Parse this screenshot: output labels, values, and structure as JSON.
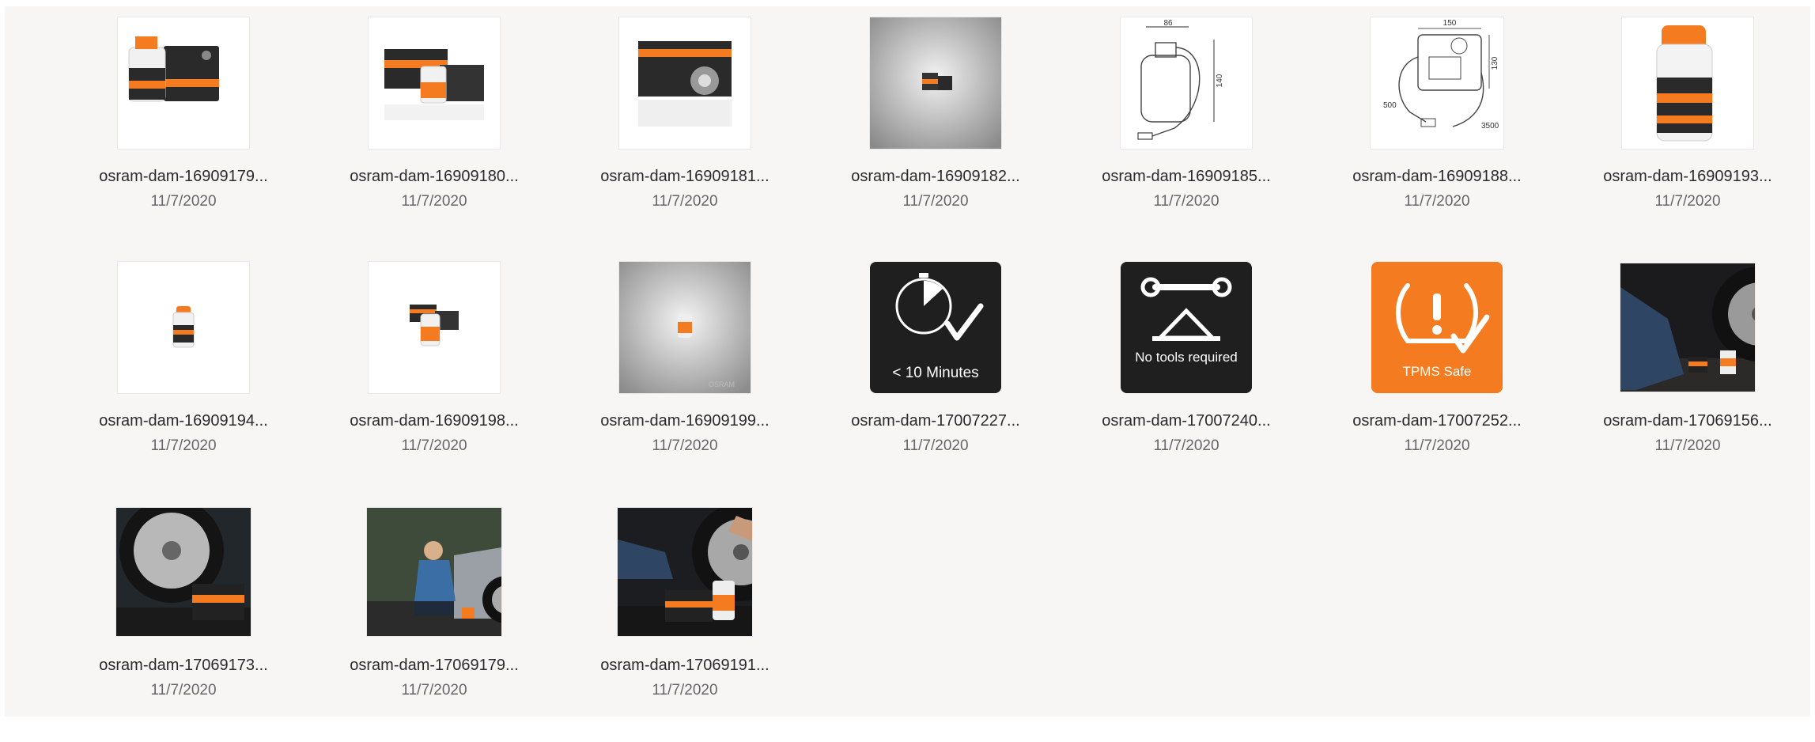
{
  "files": [
    {
      "name": "osram-dam-16909179...",
      "date": "11/7/2020",
      "kind": "product-kit"
    },
    {
      "name": "osram-dam-16909180...",
      "date": "11/7/2020",
      "kind": "product-kit-box"
    },
    {
      "name": "osram-dam-16909181...",
      "date": "11/7/2020",
      "kind": "product-box"
    },
    {
      "name": "osram-dam-16909182...",
      "date": "11/7/2020",
      "kind": "product-grey-small"
    },
    {
      "name": "osram-dam-16909185...",
      "date": "11/7/2020",
      "kind": "dimension-drawing-bottle",
      "labels": [
        "86",
        "140"
      ]
    },
    {
      "name": "osram-dam-16909188...",
      "date": "11/7/2020",
      "kind": "dimension-drawing-compressor",
      "labels": [
        "150",
        "130",
        "500",
        "3500"
      ]
    },
    {
      "name": "osram-dam-16909193...",
      "date": "11/7/2020",
      "kind": "product-bottle"
    },
    {
      "name": "osram-dam-16909194...",
      "date": "11/7/2020",
      "kind": "product-bottle-small"
    },
    {
      "name": "osram-dam-16909198...",
      "date": "11/7/2020",
      "kind": "product-kit-small"
    },
    {
      "name": "osram-dam-16909199...",
      "date": "11/7/2020",
      "kind": "product-grey-bottle",
      "watermark": "OSRAM"
    },
    {
      "name": "osram-dam-17007227...",
      "date": "11/7/2020",
      "kind": "icon-timer",
      "caption": "< 10 Minutes"
    },
    {
      "name": "osram-dam-17007240...",
      "date": "11/7/2020",
      "kind": "icon-no-tools",
      "caption": "No tools required"
    },
    {
      "name": "osram-dam-17007252...",
      "date": "11/7/2020",
      "kind": "icon-tpms",
      "caption": "TPMS Safe"
    },
    {
      "name": "osram-dam-17069156...",
      "date": "11/7/2020",
      "kind": "photo-wheel-hand"
    },
    {
      "name": "osram-dam-17069173...",
      "date": "11/7/2020",
      "kind": "photo-wheel-kit"
    },
    {
      "name": "osram-dam-17069179...",
      "date": "11/7/2020",
      "kind": "photo-man-car"
    },
    {
      "name": "osram-dam-17069191...",
      "date": "11/7/2020",
      "kind": "photo-hands-tyre"
    }
  ],
  "colors": {
    "accent": "#f47b20",
    "icon_dark": "#1f1f1f",
    "date_text": "#666666"
  }
}
